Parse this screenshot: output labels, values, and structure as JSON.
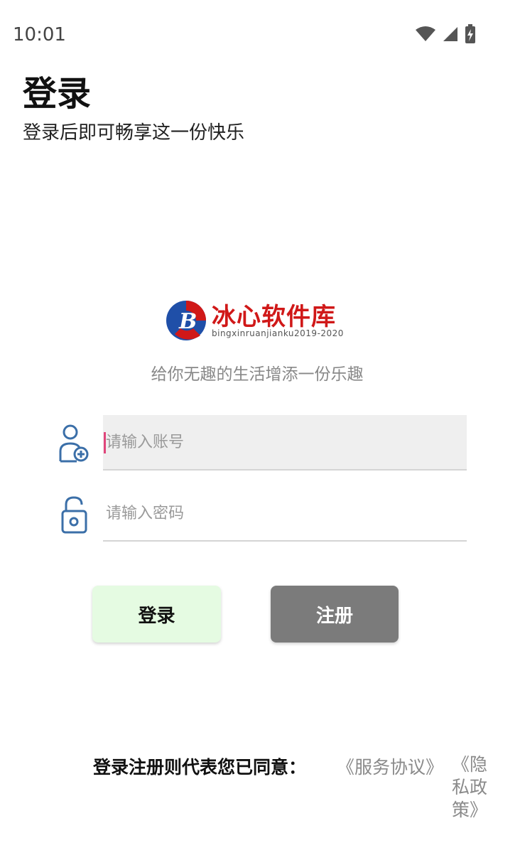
{
  "status_bar": {
    "time": "10:01",
    "icons": [
      "wifi-icon",
      "signal-icon",
      "battery-charging-icon"
    ]
  },
  "header": {
    "title": "登录",
    "subtitle": "登录后即可畅享这一份快乐"
  },
  "logo": {
    "name": "冰心软件库",
    "url": "bingxinruanjianku2019-2020",
    "colors": {
      "red": "#d01818",
      "blue": "#1f4fa8"
    }
  },
  "slogan": "给你无趣的生活增添一份乐趣",
  "form": {
    "account": {
      "icon": "user-add-icon",
      "placeholder": "请输入账号",
      "value": ""
    },
    "password": {
      "icon": "unlock-icon",
      "placeholder": "请输入密码",
      "value": ""
    }
  },
  "buttons": {
    "login_label": "登录",
    "register_label": "注册"
  },
  "agreement": {
    "prefix": "登录注册则代表您已同意：",
    "service_link": "《服务协议》",
    "privacy_link": "《隐私政策》"
  },
  "colors": {
    "login_button_bg": "#e5fbe2",
    "register_button_bg": "#7b7b7b",
    "icon_blue": "#3b6fa8",
    "cursor": "#e0457b",
    "link_gray": "#8a8a8a"
  }
}
